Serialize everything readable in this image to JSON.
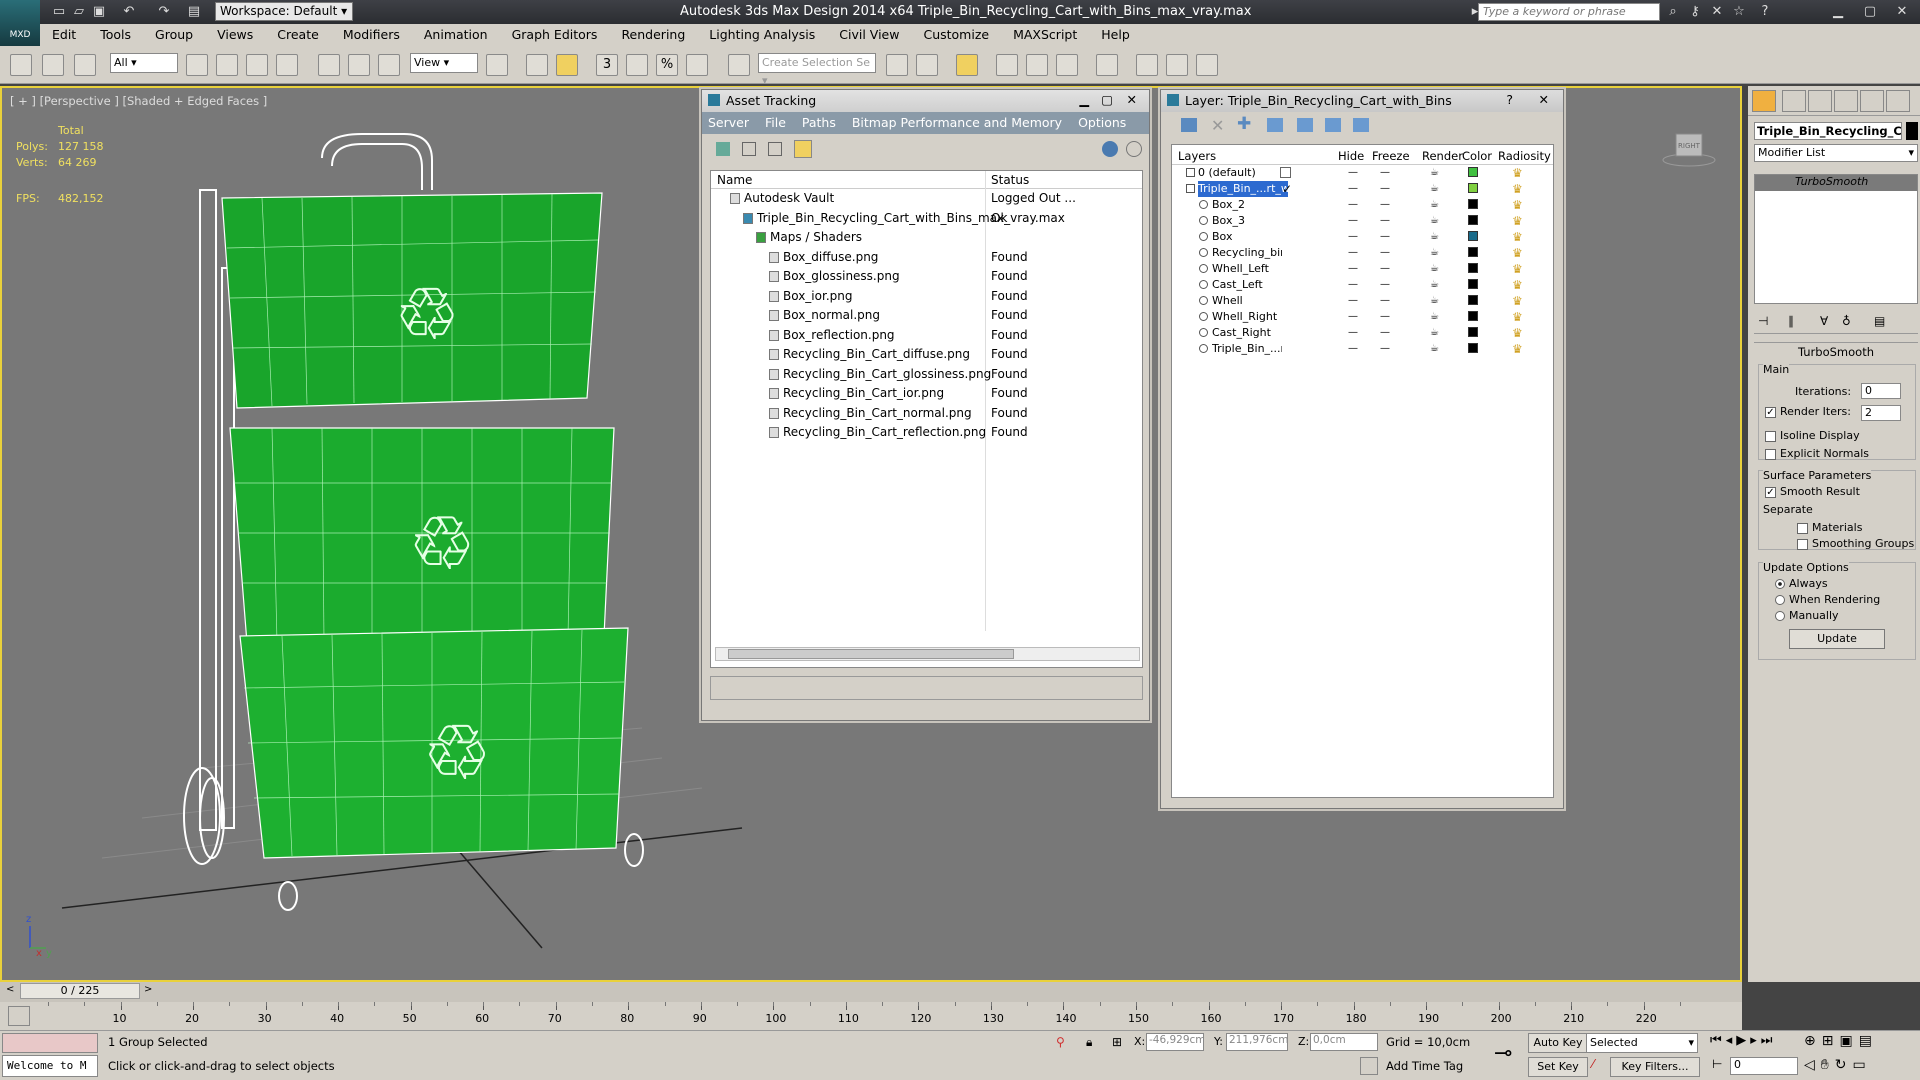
{
  "app": {
    "logo_text": "MXD",
    "workspace": "Workspace: Default",
    "title": "Autodesk 3ds Max Design 2014 x64     Triple_Bin_Recycling_Cart_with_Bins_max_vray.max",
    "search_placeholder": "Type a keyword or phrase"
  },
  "menu": [
    "Edit",
    "Tools",
    "Group",
    "Views",
    "Create",
    "Modifiers",
    "Animation",
    "Graph Editors",
    "Rendering",
    "Lighting Analysis",
    "Civil View",
    "Customize",
    "MAXScript",
    "Help"
  ],
  "toolbar": {
    "filter": "All",
    "ref_coord": "View",
    "selection_set_placeholder": "Create Selection Se",
    "snap_labels": [
      "3",
      "%"
    ]
  },
  "viewport": {
    "label": "[ + ] [Perspective ] [Shaded + Edged Faces ]",
    "stats": {
      "total": "Total",
      "polys_label": "Polys:",
      "polys": "127 158",
      "verts_label": "Verts:",
      "verts": "64 269",
      "fps_label": "FPS:",
      "fps": "482,152"
    },
    "axis_z": "z",
    "axis_x": "x",
    "axis_y": "y",
    "viewcube_label": "RIGHT"
  },
  "asset_tracking": {
    "title": "Asset Tracking",
    "menus": [
      "Server",
      "File",
      "Paths",
      "Bitmap Performance and Memory",
      "Options"
    ],
    "col_name": "Name",
    "col_status": "Status",
    "rows": [
      {
        "name": "Autodesk Vault",
        "status": "Logged Out ...",
        "indent": 1
      },
      {
        "name": "Triple_Bin_Recycling_Cart_with_Bins_max_vray.max",
        "status": "Ok",
        "indent": 2
      },
      {
        "name": "Maps / Shaders",
        "status": "",
        "indent": 3
      },
      {
        "name": "Box_diffuse.png",
        "status": "Found",
        "indent": 4
      },
      {
        "name": "Box_glossiness.png",
        "status": "Found",
        "indent": 4
      },
      {
        "name": "Box_ior.png",
        "status": "Found",
        "indent": 4
      },
      {
        "name": "Box_normal.png",
        "status": "Found",
        "indent": 4
      },
      {
        "name": "Box_reflection.png",
        "status": "Found",
        "indent": 4
      },
      {
        "name": "Recycling_Bin_Cart_diffuse.png",
        "status": "Found",
        "indent": 4
      },
      {
        "name": "Recycling_Bin_Cart_glossiness.png",
        "status": "Found",
        "indent": 4
      },
      {
        "name": "Recycling_Bin_Cart_ior.png",
        "status": "Found",
        "indent": 4
      },
      {
        "name": "Recycling_Bin_Cart_normal.png",
        "status": "Found",
        "indent": 4
      },
      {
        "name": "Recycling_Bin_Cart_reflection.png",
        "status": "Found",
        "indent": 4
      }
    ]
  },
  "layer_window": {
    "title": "Layer: Triple_Bin_Recycling_Cart_with_Bins",
    "cols": [
      "Layers",
      "Hide",
      "Freeze",
      "Render",
      "Color",
      "Radiosity"
    ],
    "rows": [
      {
        "name": "0 (default)",
        "color": "#40c040",
        "indent": 1,
        "selected": false
      },
      {
        "name": "Triple_Bin_...rt_with",
        "color": "#80d040",
        "indent": 1,
        "selected": true
      },
      {
        "name": "Box_2",
        "color": "#000000",
        "indent": 2,
        "selected": false
      },
      {
        "name": "Box_3",
        "color": "#000000",
        "indent": 2,
        "selected": false
      },
      {
        "name": "Box",
        "color": "#1a6b8a",
        "indent": 2,
        "selected": false
      },
      {
        "name": "Recycling_bin_C",
        "color": "#000000",
        "indent": 2,
        "selected": false
      },
      {
        "name": "Whell_Left",
        "color": "#000000",
        "indent": 2,
        "selected": false
      },
      {
        "name": "Cast_Left",
        "color": "#000000",
        "indent": 2,
        "selected": false
      },
      {
        "name": "Whell",
        "color": "#000000",
        "indent": 2,
        "selected": false
      },
      {
        "name": "Whell_Right",
        "color": "#000000",
        "indent": 2,
        "selected": false
      },
      {
        "name": "Cast_Right",
        "color": "#000000",
        "indent": 2,
        "selected": false
      },
      {
        "name": "Triple_Bin_...rt_s",
        "color": "#000000",
        "indent": 2,
        "selected": false
      }
    ]
  },
  "command_panel": {
    "object_name": "Triple_Bin_Recycling_Car",
    "modifier_list": "Modifier List",
    "stack_item": "TurboSmooth",
    "rollout_title": "TurboSmooth",
    "main_label": "Main",
    "iterations_label": "Iterations:",
    "iterations": "0",
    "render_iters_label": "Render Iters:",
    "render_iters": "2",
    "isoline": "Isoline Display",
    "explicit_normals": "Explicit Normals",
    "surface_params": "Surface Parameters",
    "smooth_result": "Smooth Result",
    "separate": "Separate",
    "materials": "Materials",
    "smoothing_groups": "Smoothing Groups",
    "update_options": "Update Options",
    "always": "Always",
    "when_rendering": "When Rendering",
    "manually": "Manually",
    "update_button": "Update"
  },
  "timeline": {
    "frame": "0 / 225",
    "ticks": [
      "10",
      "20",
      "30",
      "40",
      "50",
      "60",
      "70",
      "80",
      "90",
      "100",
      "110",
      "120",
      "130",
      "140",
      "150",
      "160",
      "170",
      "180",
      "190",
      "200",
      "210",
      "220"
    ]
  },
  "status": {
    "welcome": "Welcome to M",
    "selected": "1 Group Selected",
    "prompt": "Click or click-and-drag to select objects",
    "x_label": "X:",
    "x": "-46,929cm",
    "y_label": "Y:",
    "y": "211,976cm",
    "z_label": "Z:",
    "z": "0,0cm",
    "grid": "Grid = 10,0cm",
    "add_time_tag": "Add Time Tag",
    "auto_key": "Auto Key",
    "set_key": "Set Key",
    "selected_dd": "Selected",
    "key_filters": "Key Filters...",
    "frame_field": "0"
  }
}
